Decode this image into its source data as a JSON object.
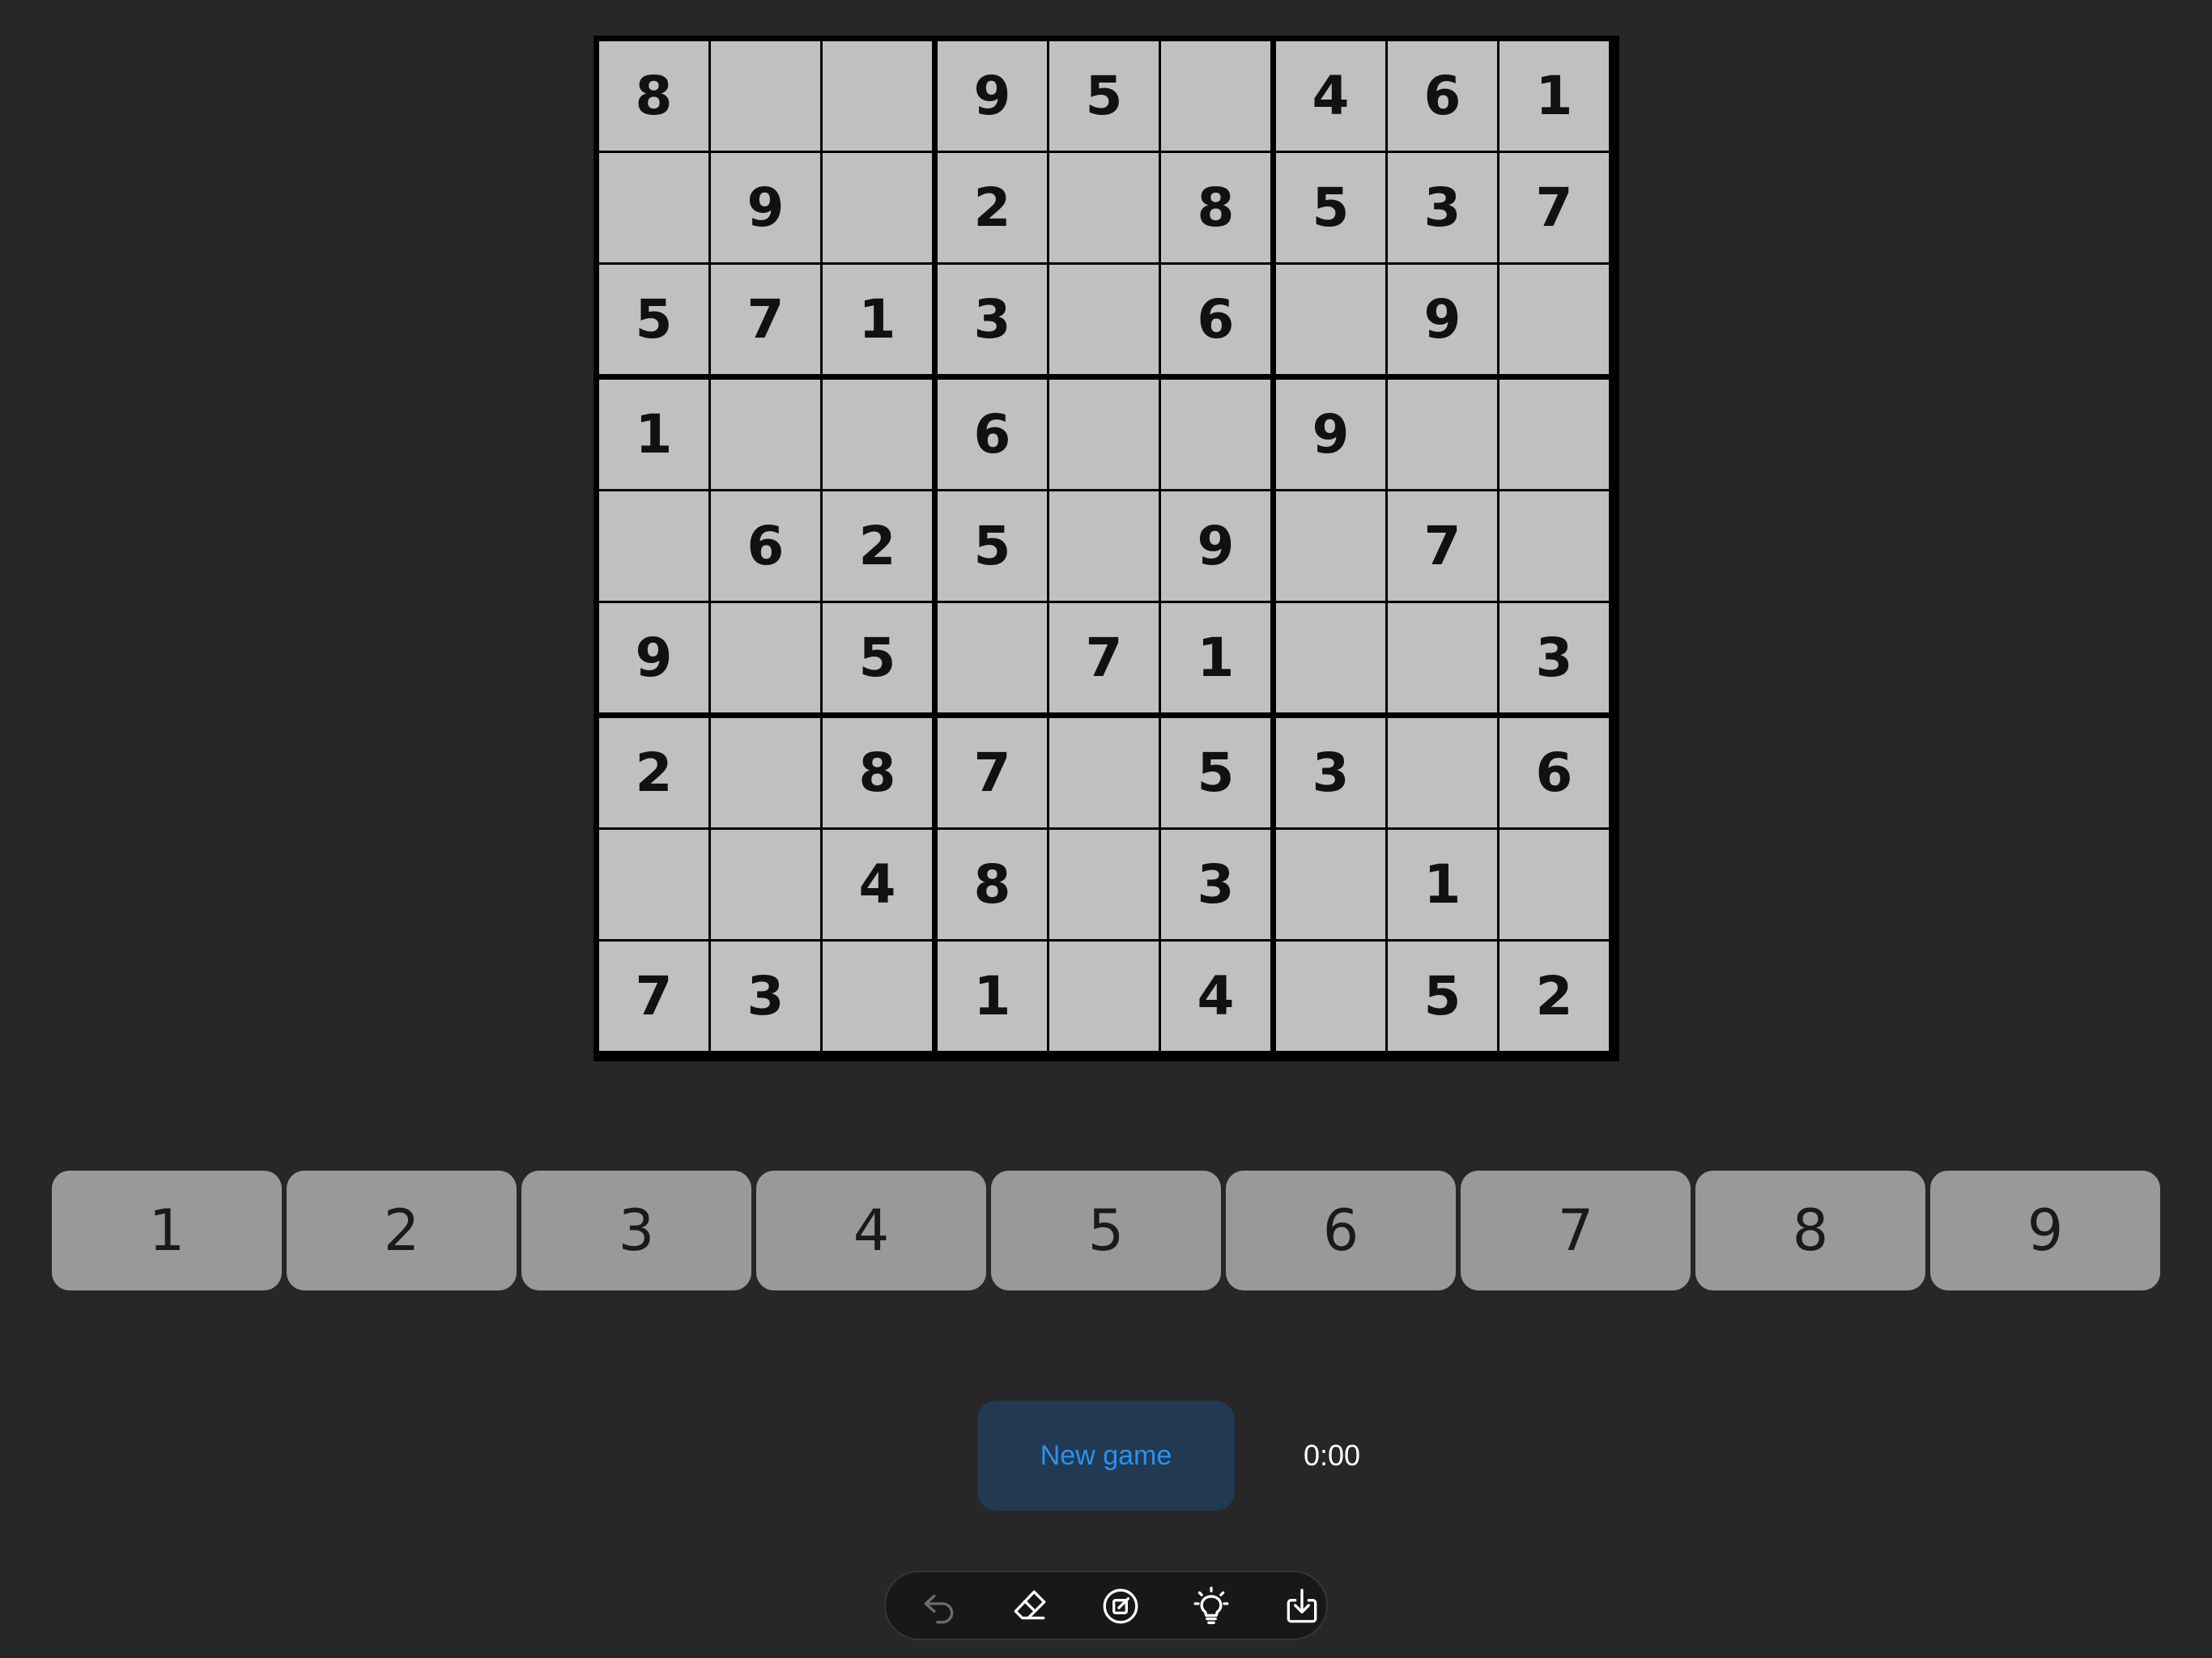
{
  "board": {
    "rows": [
      [
        "8",
        "",
        "",
        "9",
        "5",
        "",
        "4",
        "6",
        "1"
      ],
      [
        "",
        "9",
        "",
        "2",
        "",
        "8",
        "5",
        "3",
        "7"
      ],
      [
        "5",
        "7",
        "1",
        "3",
        "",
        "6",
        "",
        "9",
        ""
      ],
      [
        "1",
        "",
        "",
        "6",
        "",
        "",
        "9",
        "",
        ""
      ],
      [
        "",
        "6",
        "2",
        "5",
        "",
        "9",
        "",
        "7",
        ""
      ],
      [
        "9",
        "",
        "5",
        "",
        "7",
        "1",
        "",
        "",
        "3"
      ],
      [
        "2",
        "",
        "8",
        "7",
        "",
        "5",
        "3",
        "",
        "6"
      ],
      [
        "",
        "",
        "4",
        "8",
        "",
        "3",
        "",
        "1",
        ""
      ],
      [
        "7",
        "3",
        "",
        "1",
        "",
        "4",
        "",
        "5",
        "2"
      ]
    ]
  },
  "numpad": {
    "keys": [
      "1",
      "2",
      "3",
      "4",
      "5",
      "6",
      "7",
      "8",
      "9"
    ]
  },
  "controls": {
    "new_game_label": "New game",
    "timer": "0:00"
  },
  "toolbar": {
    "tools": [
      {
        "name": "undo-icon",
        "enabled": false
      },
      {
        "name": "eraser-icon",
        "enabled": true
      },
      {
        "name": "notes-icon",
        "enabled": true
      },
      {
        "name": "hint-icon",
        "enabled": true
      },
      {
        "name": "save-icon",
        "enabled": true
      }
    ]
  },
  "colors": {
    "background": "#272727",
    "cell": "#c0c0c0",
    "grid_line": "#000000",
    "numpad_key": "#999999",
    "new_game_bg": "#213a52",
    "new_game_text": "#2b91f0",
    "toolbar_bg": "#181818",
    "icon_enabled": "#ffffff",
    "icon_disabled": "#6d6d6d"
  }
}
